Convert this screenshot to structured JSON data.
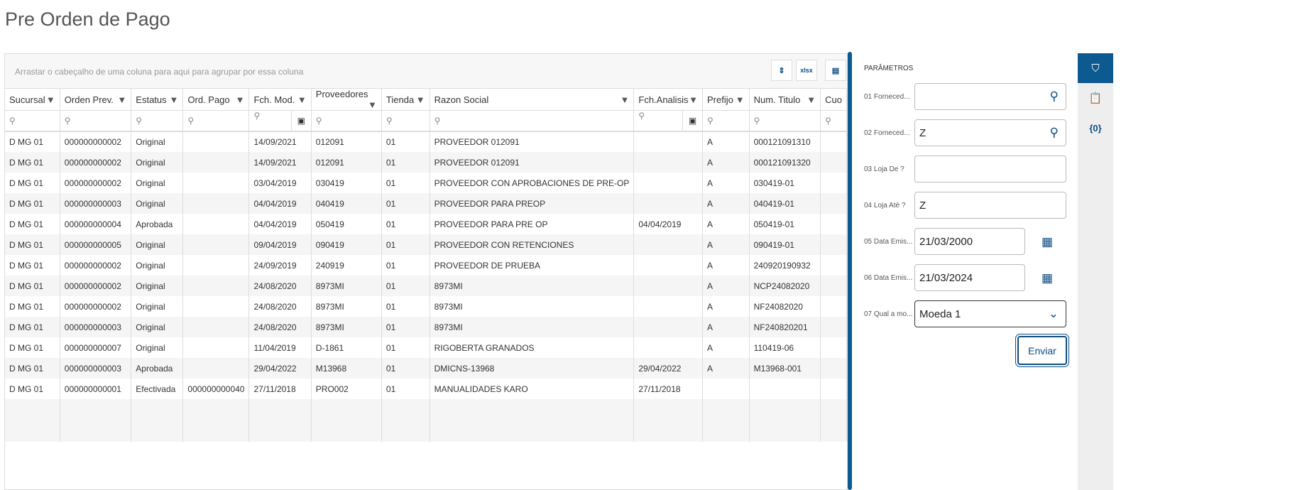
{
  "title": "Pre Orden de Pago",
  "group_hint": "Arrastar o cabeçalho de uma coluna para aqui para agrupar por essa coluna",
  "toolbar": {
    "collapse": "⇕",
    "xlsx": "xlsx",
    "columns": "▤"
  },
  "columns": [
    "Sucursal",
    "Orden Prev.",
    "Estatus",
    "Ord. Pago",
    "Fch. Mod.",
    "Proveedores",
    "Tienda",
    "Razon Social",
    "Fch.Analisis",
    "Prefijo",
    "Num. Titulo",
    "Cuo"
  ],
  "rows": [
    [
      "D MG 01",
      "000000000002",
      "Original",
      "",
      "14/09/2021",
      "012091",
      "01",
      "PROVEEDOR 012091",
      "",
      "A",
      "000121091310",
      ""
    ],
    [
      "D MG 01",
      "000000000002",
      "Original",
      "",
      "14/09/2021",
      "012091",
      "01",
      "PROVEEDOR 012091",
      "",
      "A",
      "000121091320",
      ""
    ],
    [
      "D MG 01",
      "000000000002",
      "Original",
      "",
      "03/04/2019",
      "030419",
      "01",
      "PROVEEDOR CON APROBACIONES DE PRE-OP",
      "",
      "A",
      "030419-01",
      ""
    ],
    [
      "D MG 01",
      "000000000003",
      "Original",
      "",
      "04/04/2019",
      "040419",
      "01",
      "PROVEEDOR PARA PREOP",
      "",
      "A",
      "040419-01",
      ""
    ],
    [
      "D MG 01",
      "000000000004",
      "Aprobada",
      "",
      "04/04/2019",
      "050419",
      "01",
      "PROVEEDOR PARA PRE OP",
      "04/04/2019",
      "A",
      "050419-01",
      ""
    ],
    [
      "D MG 01",
      "000000000005",
      "Original",
      "",
      "09/04/2019",
      "090419",
      "01",
      "PROVEEDOR CON RETENCIONES",
      "",
      "A",
      "090419-01",
      ""
    ],
    [
      "D MG 01",
      "000000000002",
      "Original",
      "",
      "24/09/2019",
      "240919",
      "01",
      "PROVEEDOR DE PRUEBA",
      "",
      "A",
      "240920190932",
      ""
    ],
    [
      "D MG 01",
      "000000000002",
      "Original",
      "",
      "24/08/2020",
      "8973MI",
      "01",
      "8973MI",
      "",
      "A",
      "NCP24082020",
      ""
    ],
    [
      "D MG 01",
      "000000000002",
      "Original",
      "",
      "24/08/2020",
      "8973MI",
      "01",
      "8973MI",
      "",
      "A",
      "NF24082020",
      ""
    ],
    [
      "D MG 01",
      "000000000003",
      "Original",
      "",
      "24/08/2020",
      "8973MI",
      "01",
      "8973MI",
      "",
      "A",
      "NF240820201",
      ""
    ],
    [
      "D MG 01",
      "000000000007",
      "Original",
      "",
      "11/04/2019",
      "D-1861",
      "01",
      "RIGOBERTA GRANADOS",
      "",
      "A",
      "110419-06",
      ""
    ],
    [
      "D MG 01",
      "000000000003",
      "Aprobada",
      "",
      "29/04/2022",
      "M13968",
      "01",
      "DMICNS-13968",
      "29/04/2022",
      "A",
      "M13968-001",
      ""
    ],
    [
      "D MG 01",
      "000000000001",
      "Efectivada",
      "000000000040",
      "27/11/2018",
      "PRO002",
      "01",
      "MANUALIDADES KARO",
      "27/11/2018",
      "",
      "",
      ""
    ]
  ],
  "params": {
    "title": "PARÂMETROS",
    "send": "Enviar",
    "fields": [
      {
        "label": "01 Forneced...",
        "value": ""
      },
      {
        "label": "02 Forneced...",
        "value": "Z"
      },
      {
        "label": "03 Loja De ?",
        "value": ""
      },
      {
        "label": "04 Loja Até ?",
        "value": "Z"
      },
      {
        "label": "05 Data Emis...",
        "value": "21/03/2000"
      },
      {
        "label": "06 Data Emis...",
        "value": "21/03/2024"
      },
      {
        "label": "07 Qual a mo...",
        "value": "Moeda 1"
      }
    ]
  },
  "rail": {
    "filter": "⛉",
    "clipboard": "📋",
    "vars": "{0}"
  }
}
